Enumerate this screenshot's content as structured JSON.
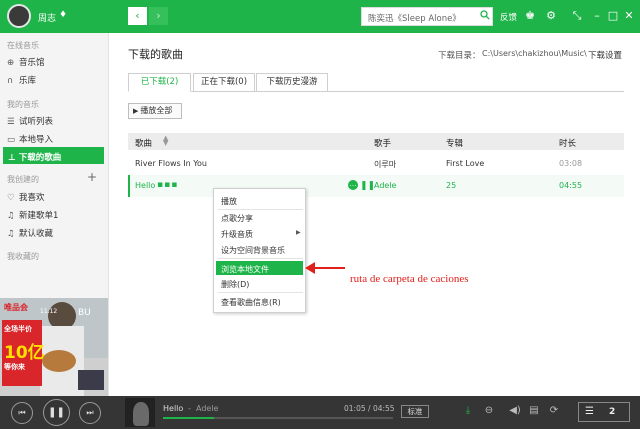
{
  "topbar": {
    "username": "周志",
    "vip_icon": "diamond-icon",
    "search_placeholder": "陈奕迅《Sleep Alone》",
    "feedback_label": "反馈"
  },
  "sidebar": {
    "online_header": "在线音乐",
    "online_items": [
      {
        "label": "音乐馆",
        "icon": "music-hall-icon"
      },
      {
        "label": "乐库",
        "icon": "headphone-icon"
      }
    ],
    "my_music_header": "我的音乐",
    "my_music_items": [
      {
        "label": "试听列表",
        "icon": "list-icon"
      },
      {
        "label": "本地导入",
        "icon": "folder-icon"
      },
      {
        "label": "下载的歌曲",
        "icon": "download-icon"
      }
    ],
    "created_header": "我创建的",
    "created_items": [
      {
        "label": "我喜欢",
        "icon": "heart-icon"
      },
      {
        "label": "新建歌单1",
        "icon": "playlist-icon"
      },
      {
        "label": "默认收藏",
        "icon": "playlist-icon"
      }
    ],
    "collected_header": "我收藏的",
    "ad": {
      "brand": "唯品会",
      "date": "11.12",
      "line1": "全场半价",
      "line2": "10亿",
      "line3": "等你来",
      "tag": "BU"
    }
  },
  "main": {
    "title": "下载的歌曲",
    "download_dir_label": "下载目录：",
    "download_dir_path": "C:\\Users\\chakizhou\\Music\\",
    "download_settings": "下载设置",
    "tabs": [
      {
        "label": "已下载(2)",
        "active": true
      },
      {
        "label": "正在下载(0)",
        "active": false
      },
      {
        "label": "下载历史漫游",
        "active": false
      }
    ],
    "play_all_label": "播放全部",
    "columns": [
      "歌曲",
      "歌手",
      "专辑",
      "时长"
    ],
    "rows": [
      {
        "song": "River Flows In You",
        "artist": "이루마",
        "album": "First Love",
        "duration": "03:08"
      },
      {
        "song": "Hello",
        "artist": "Adele",
        "album": "25",
        "duration": "04:55"
      }
    ]
  },
  "context_menu": {
    "items": [
      "播放",
      "点歌分享",
      "升级音质",
      "设为空间背景音乐",
      "浏览本地文件",
      "删除(D)",
      "查看歌曲信息(R)"
    ],
    "highlighted_index": 4
  },
  "annotation": {
    "text": "ruta de carpeta de caciones",
    "color": "#e0201a"
  },
  "player": {
    "title": "Hello",
    "separator": "-",
    "artist": "Adele",
    "time_current": "01:05",
    "time_sep": "/",
    "time_total": "04:55",
    "progress": 0.22,
    "quality": "标准",
    "playlist_count": "2"
  },
  "colors": {
    "accent": "#1fb44a",
    "player_bg": "#353535"
  }
}
